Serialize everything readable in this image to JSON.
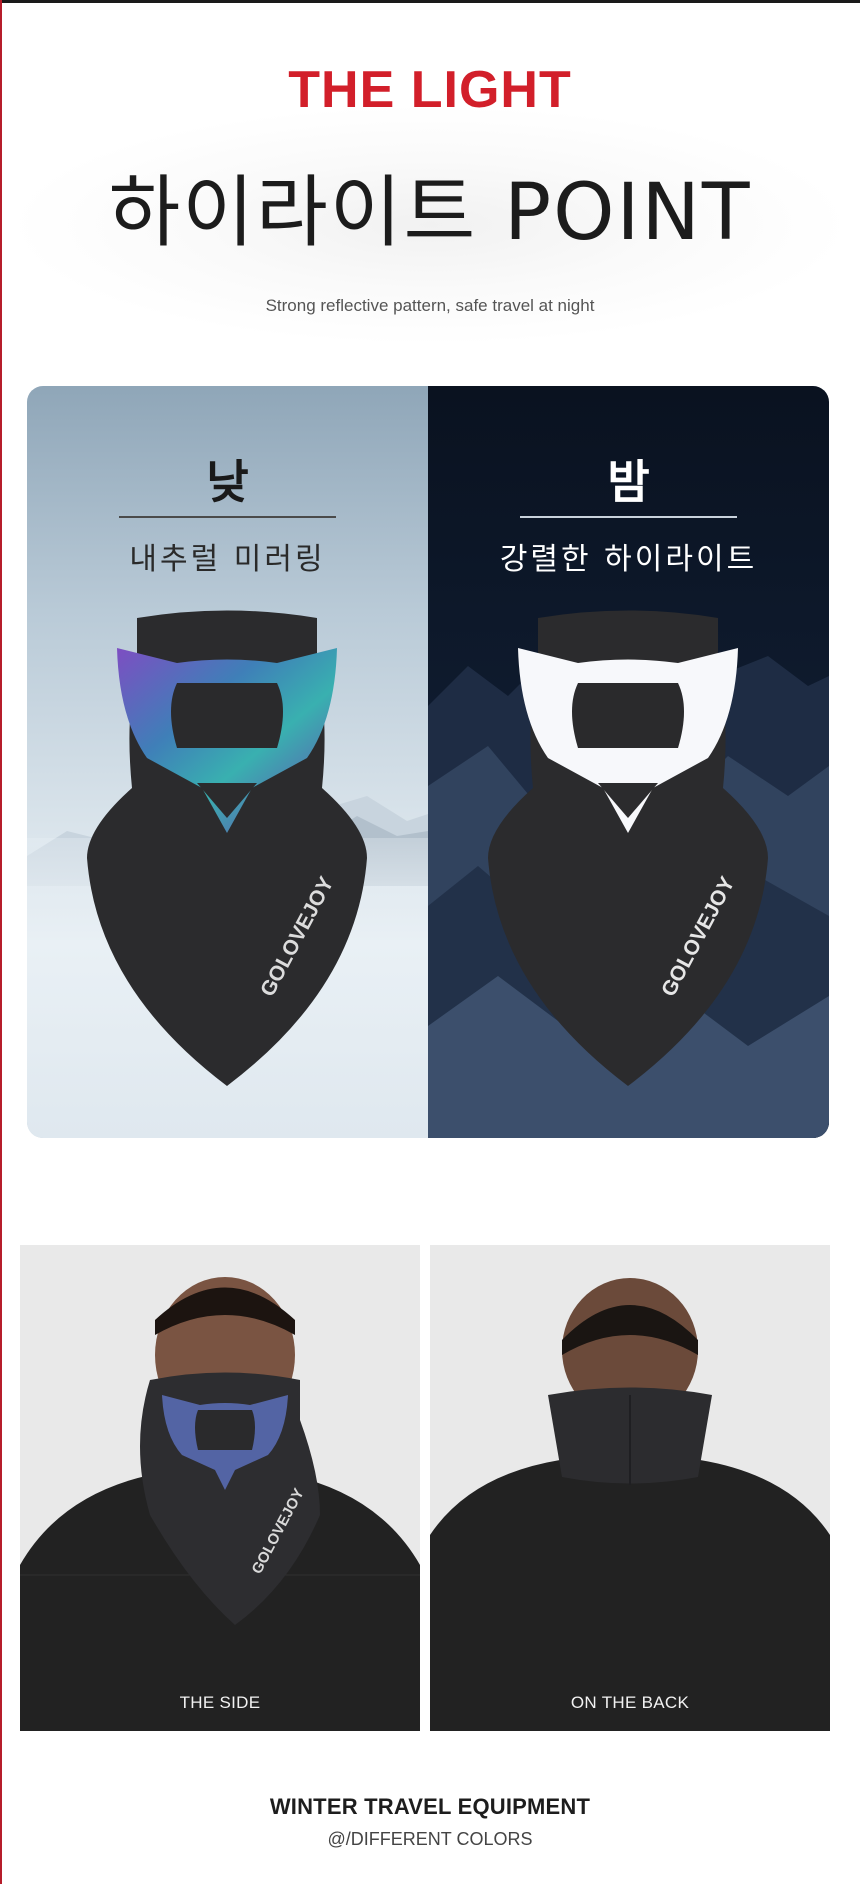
{
  "header": {
    "title_en": "THE LIGHT",
    "title_kr": "하이라이트 POINT",
    "subtitle": "Strong reflective pattern, safe travel at night",
    "accent_color": "#d21f2a"
  },
  "comparison": {
    "day": {
      "label": "낮",
      "caption": "내추럴 미러링"
    },
    "night": {
      "label": "밤",
      "caption": "강렬한 하이라이트"
    },
    "brand_print": "GOLOVEJOY"
  },
  "views": [
    {
      "caption": "THE SIDE"
    },
    {
      "caption": "ON THE BACK"
    }
  ],
  "footer": {
    "title": "WINTER TRAVEL EQUIPMENT",
    "subtitle": "@/DIFFERENT COLORS"
  }
}
